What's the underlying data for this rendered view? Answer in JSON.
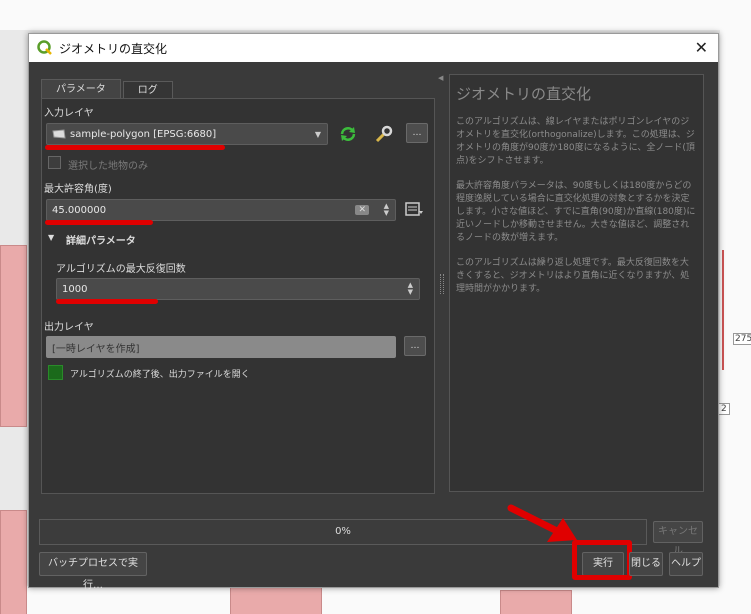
{
  "dialog": {
    "title": "ジオメトリの直交化",
    "close_glyph": "✕"
  },
  "tabs": [
    {
      "label": "パラメータ",
      "active": true
    },
    {
      "label": "ログ",
      "active": false
    }
  ],
  "params": {
    "input_layer_label": "入力レイヤ",
    "input_layer_value": "sample-polygon [EPSG:6680]",
    "selected_only_label": "選択した地物のみ",
    "max_angle_label": "最大許容角(度)",
    "max_angle_value": "45.000000",
    "advanced_label": "詳細パラメータ",
    "max_iter_label": "アルゴリズムの最大反復回数",
    "max_iter_value": "1000",
    "output_layer_label": "出力レイヤ",
    "output_layer_placeholder": "[一時レイヤを作成]",
    "open_output_label": "アルゴリズムの終了後、出力ファイルを開く",
    "browse_label": "…"
  },
  "help": {
    "title": "ジオメトリの直交化",
    "paragraphs": [
      "このアルゴリズムは、線レイヤまたはポリゴンレイヤのジオメトリを直交化(orthogonalize)します。この処理は、ジオメトリの角度が90度か180度になるように、全ノード(頂点)をシフトさせます。",
      "最大許容角度パラメータは、90度もしくは180度からどの程度逸脱している場合に直交化処理の対象とするかを決定します。小さな値ほど、すでに直角(90度)か直線(180度)に近いノードしか移動させません。大きな値ほど、調整されるノードの数が増えます。",
      "このアルゴリズムは繰り返し処理です。最大反復回数を大きくすると、ジオメトリはより直角に近くなりますが、処理時間がかかります。"
    ]
  },
  "progress": {
    "text": "0%",
    "value": 0
  },
  "buttons": {
    "cancel": "キャンセル",
    "batch": "バッチプロセスで実行…",
    "run": "実行",
    "close": "閉じる",
    "help": "ヘルプ"
  },
  "map_labels": {
    "label_275": "275",
    "label_2": "2"
  },
  "colors": {
    "annotation_red": "#e00000",
    "checkbox_green": "#1b6a1b"
  }
}
